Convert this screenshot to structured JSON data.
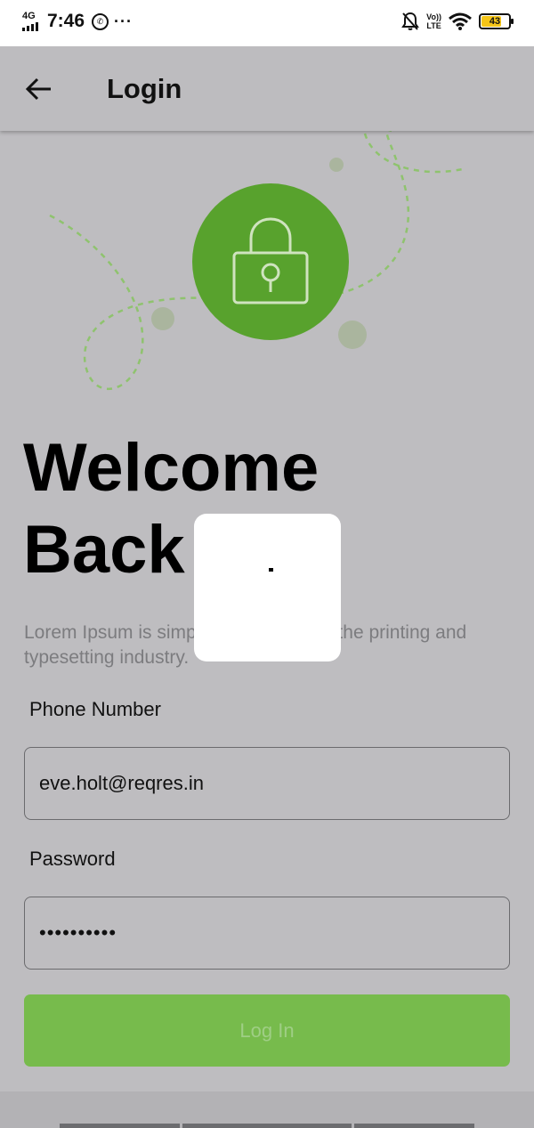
{
  "status_bar": {
    "network": "4G",
    "time": "7:46",
    "lte_top": "Vo))",
    "lte_bottom": "LTE",
    "battery": "43",
    "icons": [
      "whatsapp-icon",
      "more-dots-icon",
      "bell-off-icon",
      "wifi-icon",
      "battery-icon"
    ]
  },
  "app_bar": {
    "back_icon": "arrow-left-icon",
    "title": "Login"
  },
  "hero": {
    "icon": "lock-icon",
    "accent_color": "#58a22d"
  },
  "welcome": {
    "line1": "Welcome",
    "line2": "Back",
    "description": "Lorem Ipsum is simply dummy text of the printing and typesetting industry."
  },
  "form": {
    "phone_label": "Phone Number",
    "phone_value": "eve.holt@reqres.in",
    "password_label": "Password",
    "password_value": "••••••••••",
    "login_label": "Log In"
  },
  "loader": {
    "state": "loading"
  }
}
